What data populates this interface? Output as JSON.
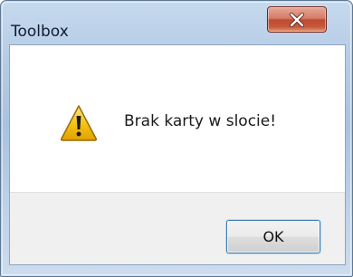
{
  "window": {
    "title": "Toolbox",
    "close_icon": "close-icon"
  },
  "dialog": {
    "icon": "warning-icon",
    "message": "Brak karty w slocie!"
  },
  "buttons": {
    "ok_label": "OK"
  },
  "colors": {
    "close_button": "#c75a40",
    "warning_fill": "#f5c518",
    "frame": "#b7cde6",
    "footer": "#f0f0f0"
  }
}
